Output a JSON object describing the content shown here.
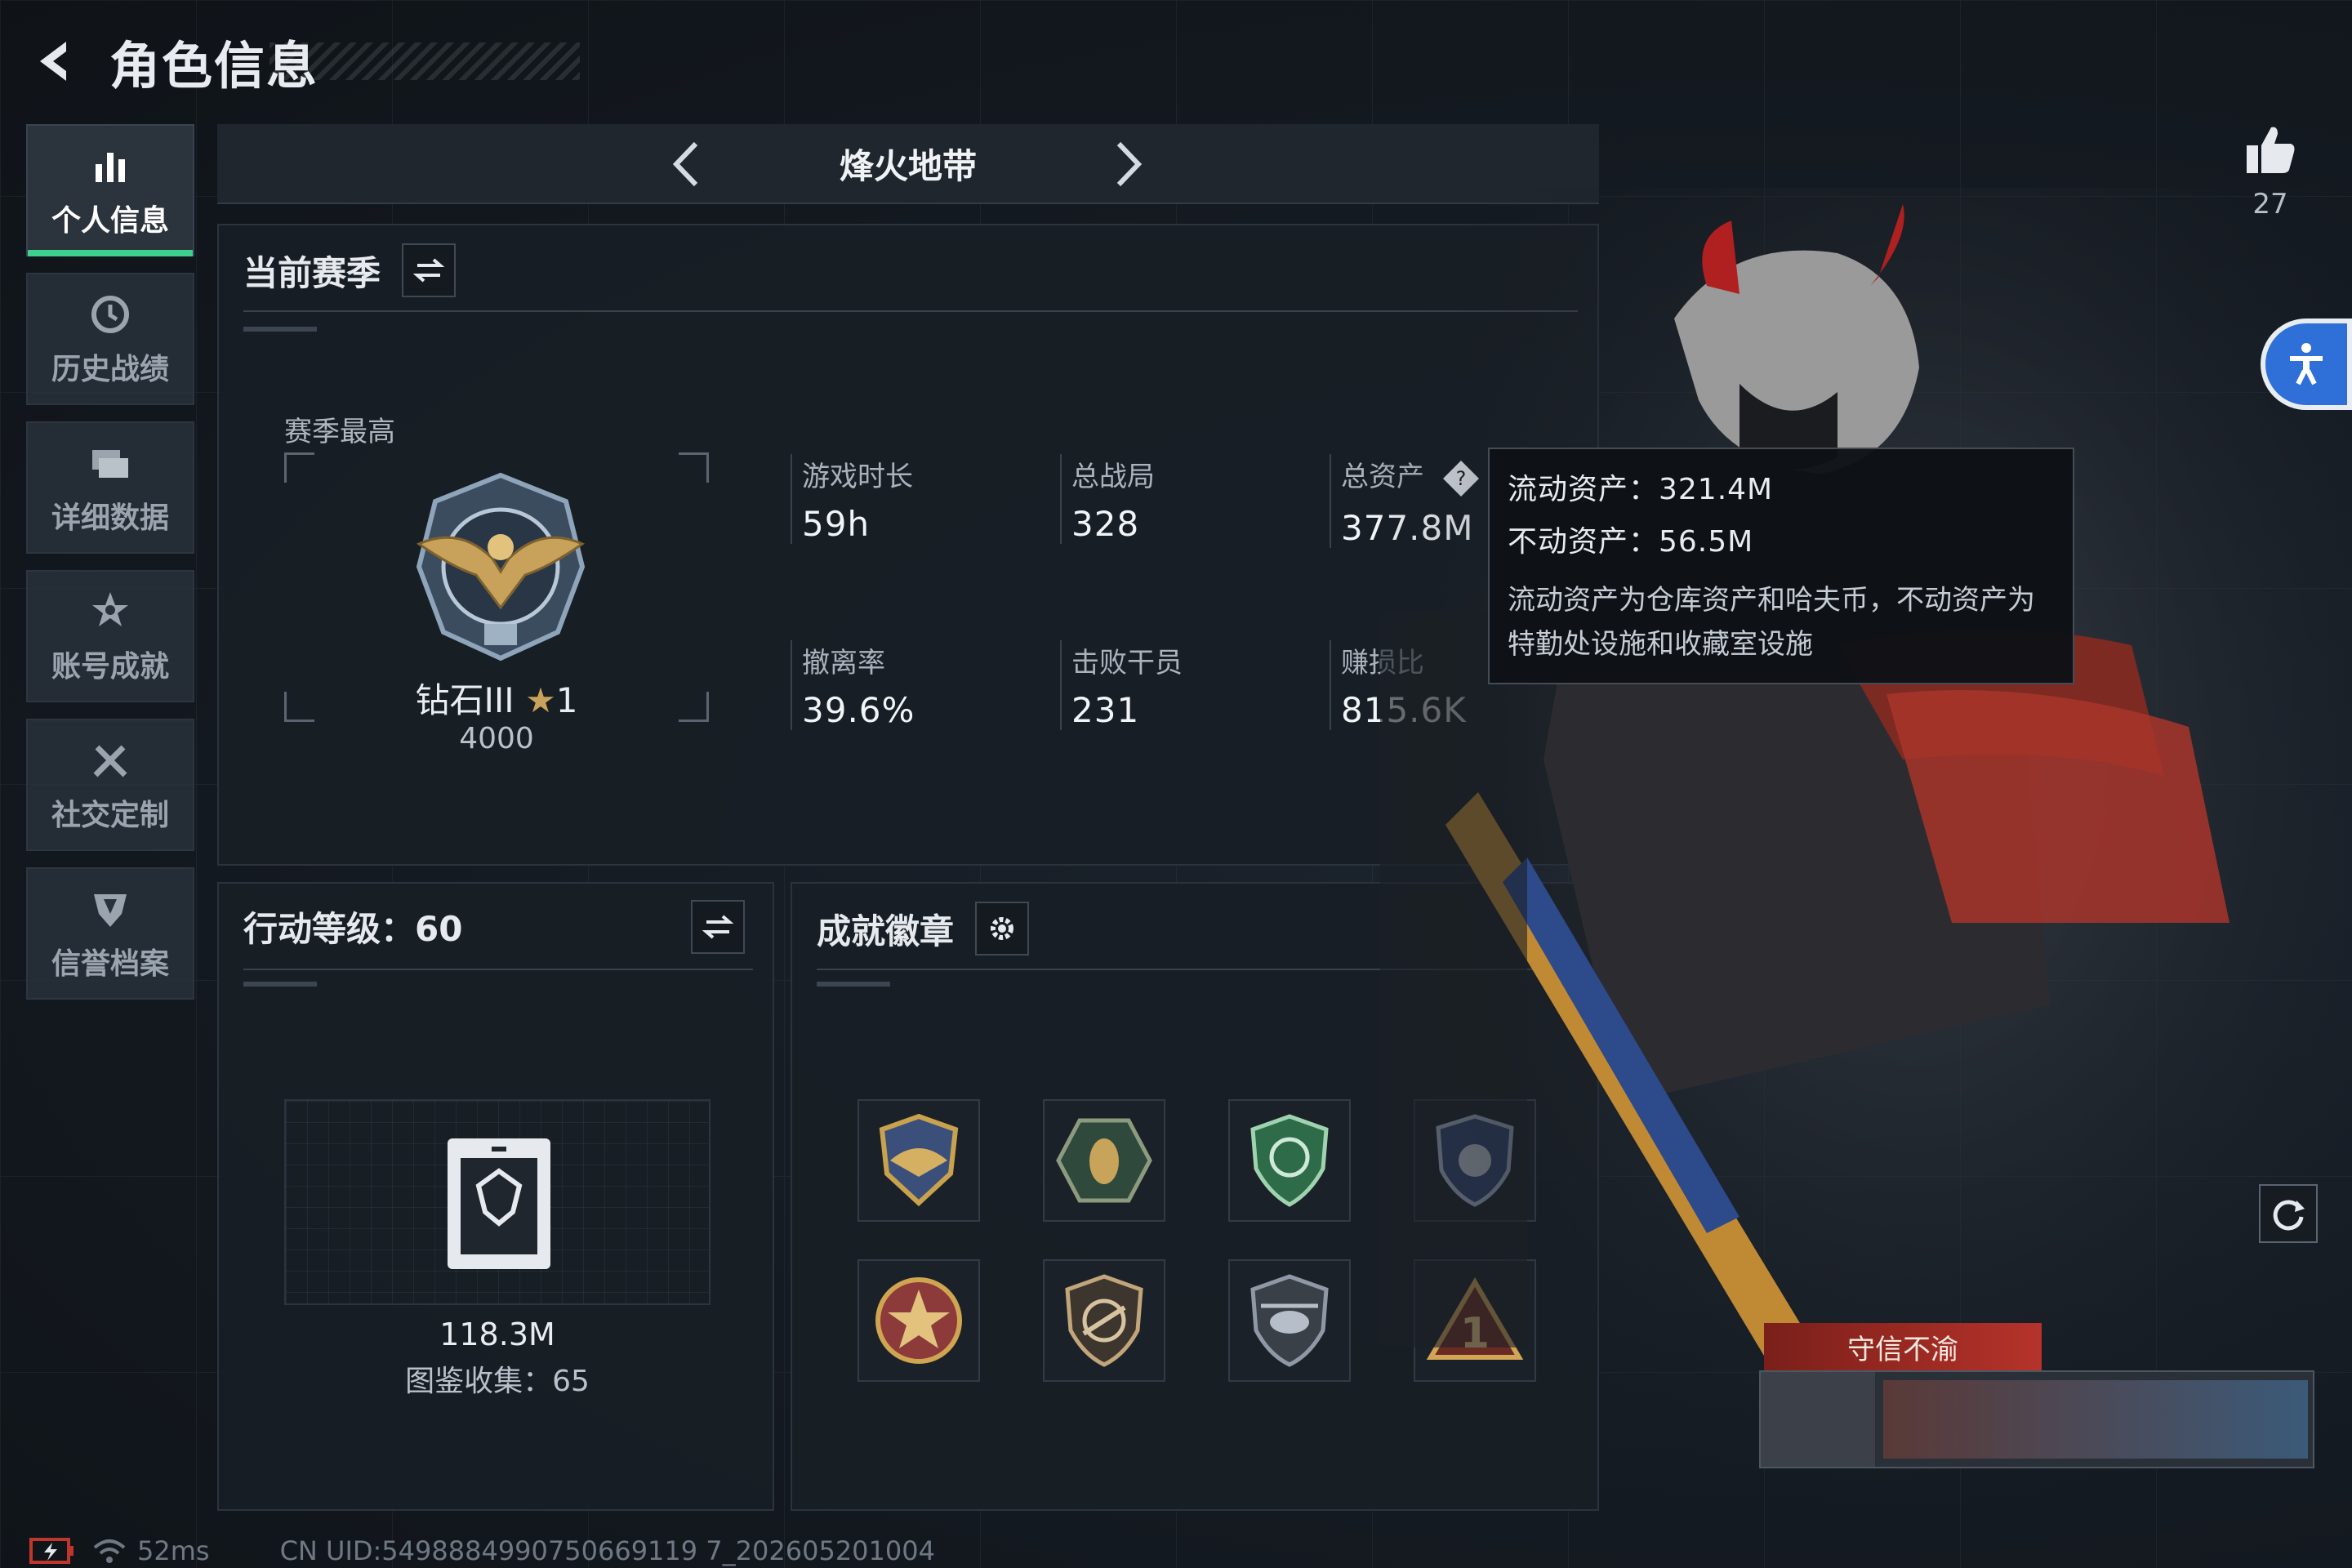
{
  "header": {
    "title": "角色信息"
  },
  "sidebar": {
    "items": [
      {
        "label": "个人信息",
        "icon": "bar-chart-icon",
        "active": true
      },
      {
        "label": "历史战绩",
        "icon": "clock-icon",
        "active": false
      },
      {
        "label": "详细数据",
        "icon": "folders-icon",
        "active": false
      },
      {
        "label": "账号成就",
        "icon": "star-gear-icon",
        "active": false
      },
      {
        "label": "社交定制",
        "icon": "tools-icon",
        "active": false
      },
      {
        "label": "信誉档案",
        "icon": "shield-v-icon",
        "active": false
      }
    ]
  },
  "mode": {
    "title": "烽火地带"
  },
  "season": {
    "title": "当前赛季",
    "best_label": "赛季最高",
    "rank_name": "钻石III",
    "rank_stars": "1",
    "rank_score": "4000",
    "stats": [
      {
        "label": "游戏时长",
        "value": "59h"
      },
      {
        "label": "总战局",
        "value": "328"
      },
      {
        "label": "总资产",
        "value": "377.8M"
      },
      {
        "label": "撤离率",
        "value": "39.6%"
      },
      {
        "label": "击败干员",
        "value": "231"
      },
      {
        "label": "赚损比",
        "value": "815.6K"
      }
    ]
  },
  "tooltip": {
    "liquid": "流动资产：321.4M",
    "fixed": "不动资产：56.5M",
    "desc": "流动资产为仓库资产和哈夫币，不动资产为特勤处设施和收藏室设施"
  },
  "action": {
    "title": "行动等级：60",
    "value": "118.3M",
    "collection": "图鉴收集：65"
  },
  "badges": {
    "title": "成就徽章",
    "items": [
      "eagle-badge-icon",
      "wasp-badge-icon",
      "green-shield-badge-icon",
      "blue-shield-badge-icon",
      "star-medal-badge-icon",
      "rifle-badge-icon",
      "helicopter-badge-icon",
      "triangle-one-badge-icon"
    ]
  },
  "character": {
    "likes": "27",
    "card_tag": "守信不渝"
  },
  "footer": {
    "ping": "52ms",
    "uid": "CN UID:5498884990750669119 7_202605201004"
  },
  "colors": {
    "accent_green": "#3fcf8e",
    "tooltip_bg": "#0e1115",
    "access_blue": "#2f6fd8"
  }
}
